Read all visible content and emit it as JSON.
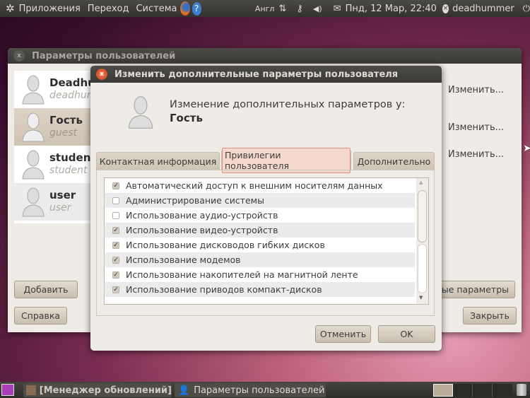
{
  "top_panel": {
    "menus": [
      "Приложения",
      "Переход",
      "Система"
    ],
    "keyboard": "Англ",
    "datetime": "Пнд, 12 Мар, 22:40",
    "user": "deadhummer"
  },
  "users_window": {
    "title": "Параметры пользователей",
    "users": [
      {
        "name": "Deadhummer",
        "login": "deadhummer"
      },
      {
        "name": "Гость",
        "login": "guest"
      },
      {
        "name": "student",
        "login": "student"
      },
      {
        "name": "user",
        "login": "user"
      }
    ],
    "edit_labels": [
      "Изменить...",
      "Изменить...",
      "Изменить..."
    ],
    "add_button": "Добавить",
    "advanced_button": "Дополнительные параметры",
    "help_button": "Справка",
    "close_button": "Закрыть"
  },
  "dialog": {
    "title": "Изменить дополнительные параметры пользователя",
    "heading": "Изменение дополнительных параметров у:",
    "user": "Гость",
    "tabs": [
      "Контактная информация",
      "Привилегии пользователя",
      "Дополнительно"
    ],
    "active_tab": 1,
    "privileges": [
      {
        "label": "Автоматический доступ к внешним носителям данных",
        "checked": true
      },
      {
        "label": "Администрирование системы",
        "checked": false
      },
      {
        "label": "Использование аудио-устройств",
        "checked": false
      },
      {
        "label": "Использование видео-устройств",
        "checked": true
      },
      {
        "label": "Использование дисководов гибких дисков",
        "checked": true
      },
      {
        "label": "Использование модемов",
        "checked": true
      },
      {
        "label": "Использование накопителей на магнитной ленте",
        "checked": true
      },
      {
        "label": "Использование приводов компакт-дисков",
        "checked": true
      }
    ],
    "cancel_button": "Отменить",
    "ok_button": "OK"
  },
  "bottom_panel": {
    "tasks": [
      "[Менеджер обновлений]",
      "Параметры пользователей"
    ]
  }
}
